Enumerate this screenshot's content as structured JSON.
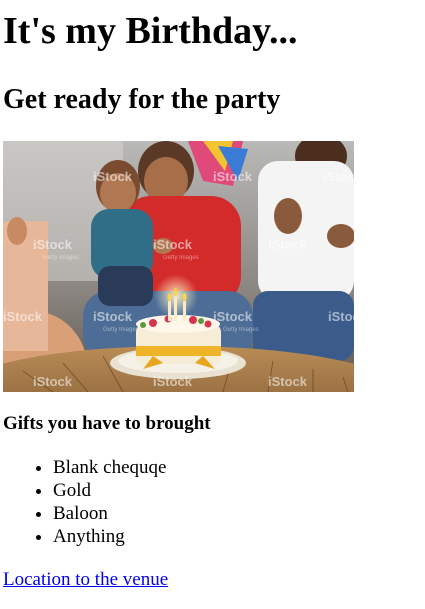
{
  "heading": "It's my Birthday...",
  "subheading": "Get ready for the party",
  "image": {
    "watermark": "iStock",
    "watermark_credit": "Getty Images"
  },
  "gifts": {
    "title": "Gifts you have to brought",
    "items": [
      "Blank chequqe",
      "Gold",
      "Baloon",
      "Anything"
    ]
  },
  "link": {
    "label": "Location to the venue",
    "color": "#0000ee"
  }
}
